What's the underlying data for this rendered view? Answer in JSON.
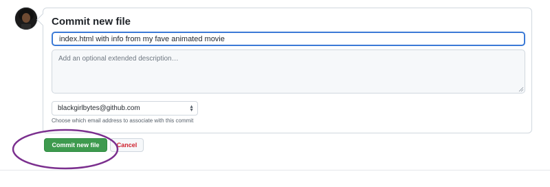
{
  "commit_form": {
    "title": "Commit new file",
    "summary_value": "index.html with info from my fave animated movie",
    "description_placeholder": "Add an optional extended description…",
    "email_selected": "blackgirlbytes@github.com",
    "email_hint": "Choose which email address to associate with this commit",
    "commit_button_label": "Commit new file",
    "cancel_button_label": "Cancel"
  },
  "icons": {
    "avatar": "user-avatar",
    "select_arrows": "chevron-up-down-icon",
    "resize_grip": "resize-grip-icon"
  },
  "colors": {
    "commit_button": "#3e9a4e",
    "cancel_text": "#cf222e",
    "focus_border": "#3a79d6",
    "annotation_ring": "#7b2f8e"
  }
}
